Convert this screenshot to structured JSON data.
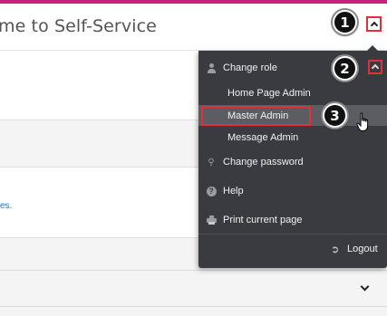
{
  "header": {
    "title": "me to Self-Service"
  },
  "markers": {
    "m1": "1",
    "m2": "2",
    "m3": "3"
  },
  "background": {
    "link_fragment": "es."
  },
  "menu": {
    "change_role_label": "Change role",
    "roles": [
      "Home Page Admin",
      "Master Admin",
      "Message Admin"
    ],
    "selected_role": "Master Admin",
    "change_password_label": "Change password",
    "help_label": "Help",
    "print_label": "Print current page",
    "logout_label": "Logout"
  },
  "icons": {
    "change_role": "person-icon",
    "change_password": "key-icon",
    "help": "help-icon",
    "print": "printer-icon",
    "logout": "logout-icon",
    "collapse": "chevron-up-icon",
    "expand": "chevron-down-icon",
    "cursor": "hand-pointer-icon"
  },
  "colors": {
    "accent_bar": "#c8237c",
    "menu_bg": "#393b41",
    "selected_bg": "#5b5d62",
    "highlight": "#e0303a",
    "link": "#1a73c8"
  }
}
